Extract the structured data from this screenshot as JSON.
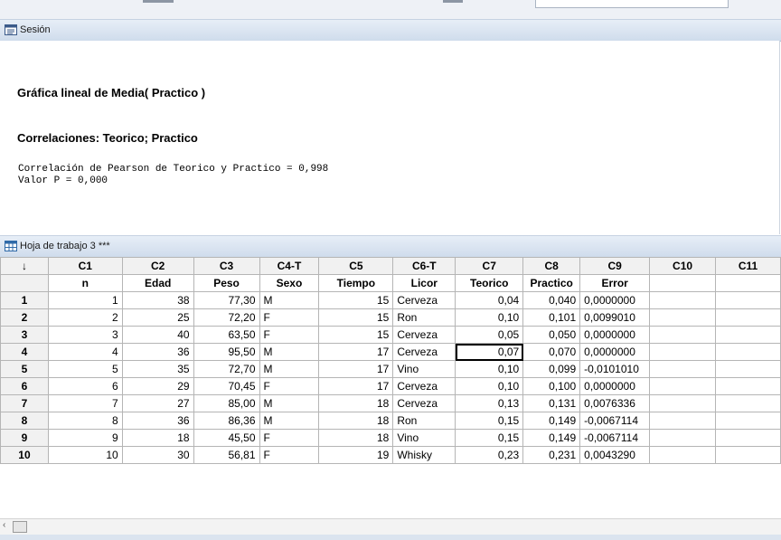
{
  "session": {
    "title": "Sesión",
    "heading1": "Gráfica lineal de Media( Practico )",
    "heading2": "Correlaciones: Teorico; Practico",
    "line1": "Correlación de Pearson de Teorico y Practico = 0,998",
    "line2": "Valor P = 0,000"
  },
  "worksheet": {
    "title": "Hoja de trabajo 3 ***",
    "corner_label": "↓",
    "columns": [
      "C1",
      "C2",
      "C3",
      "C4-T",
      "C5",
      "C6-T",
      "C7",
      "C8",
      "C9",
      "C10",
      "C11"
    ],
    "names": [
      "n",
      "Edad",
      "Peso",
      "Sexo",
      "Tiempo",
      "Licor",
      "Teorico",
      "Practico",
      "Error",
      "",
      ""
    ],
    "rows": [
      {
        "num": "1",
        "cells": [
          "1",
          "38",
          "77,30",
          "M",
          "15",
          "Cerveza",
          "0,04",
          "0,040",
          "0,0000000",
          "",
          ""
        ]
      },
      {
        "num": "2",
        "cells": [
          "2",
          "25",
          "72,20",
          "F",
          "15",
          "Ron",
          "0,10",
          "0,101",
          "0,0099010",
          "",
          ""
        ]
      },
      {
        "num": "3",
        "cells": [
          "3",
          "40",
          "63,50",
          "F",
          "15",
          "Cerveza",
          "0,05",
          "0,050",
          "0,0000000",
          "",
          ""
        ]
      },
      {
        "num": "4",
        "cells": [
          "4",
          "36",
          "95,50",
          "M",
          "17",
          "Cerveza",
          "0,07",
          "0,070",
          "0,0000000",
          "",
          ""
        ]
      },
      {
        "num": "5",
        "cells": [
          "5",
          "35",
          "72,70",
          "M",
          "17",
          "Vino",
          "0,10",
          "0,099",
          "-0,0101010",
          "",
          ""
        ]
      },
      {
        "num": "6",
        "cells": [
          "6",
          "29",
          "70,45",
          "F",
          "17",
          "Cerveza",
          "0,10",
          "0,100",
          "0,0000000",
          "",
          ""
        ]
      },
      {
        "num": "7",
        "cells": [
          "7",
          "27",
          "85,00",
          "M",
          "18",
          "Cerveza",
          "0,13",
          "0,131",
          "0,0076336",
          "",
          ""
        ]
      },
      {
        "num": "8",
        "cells": [
          "8",
          "36",
          "86,36",
          "M",
          "18",
          "Ron",
          "0,15",
          "0,149",
          "-0,0067114",
          "",
          ""
        ]
      },
      {
        "num": "9",
        "cells": [
          "9",
          "18",
          "45,50",
          "F",
          "18",
          "Vino",
          "0,15",
          "0,149",
          "-0,0067114",
          "",
          ""
        ]
      },
      {
        "num": "10",
        "cells": [
          "10",
          "30",
          "56,81",
          "F",
          "19",
          "Whisky",
          "0,23",
          "0,231",
          "0,0043290",
          "",
          ""
        ]
      }
    ]
  },
  "icons": {
    "session": "session-icon",
    "worksheet": "worksheet-icon",
    "scroll_left": "scroll-left-icon"
  },
  "scrollbar": {
    "left_arrow": "‹"
  }
}
